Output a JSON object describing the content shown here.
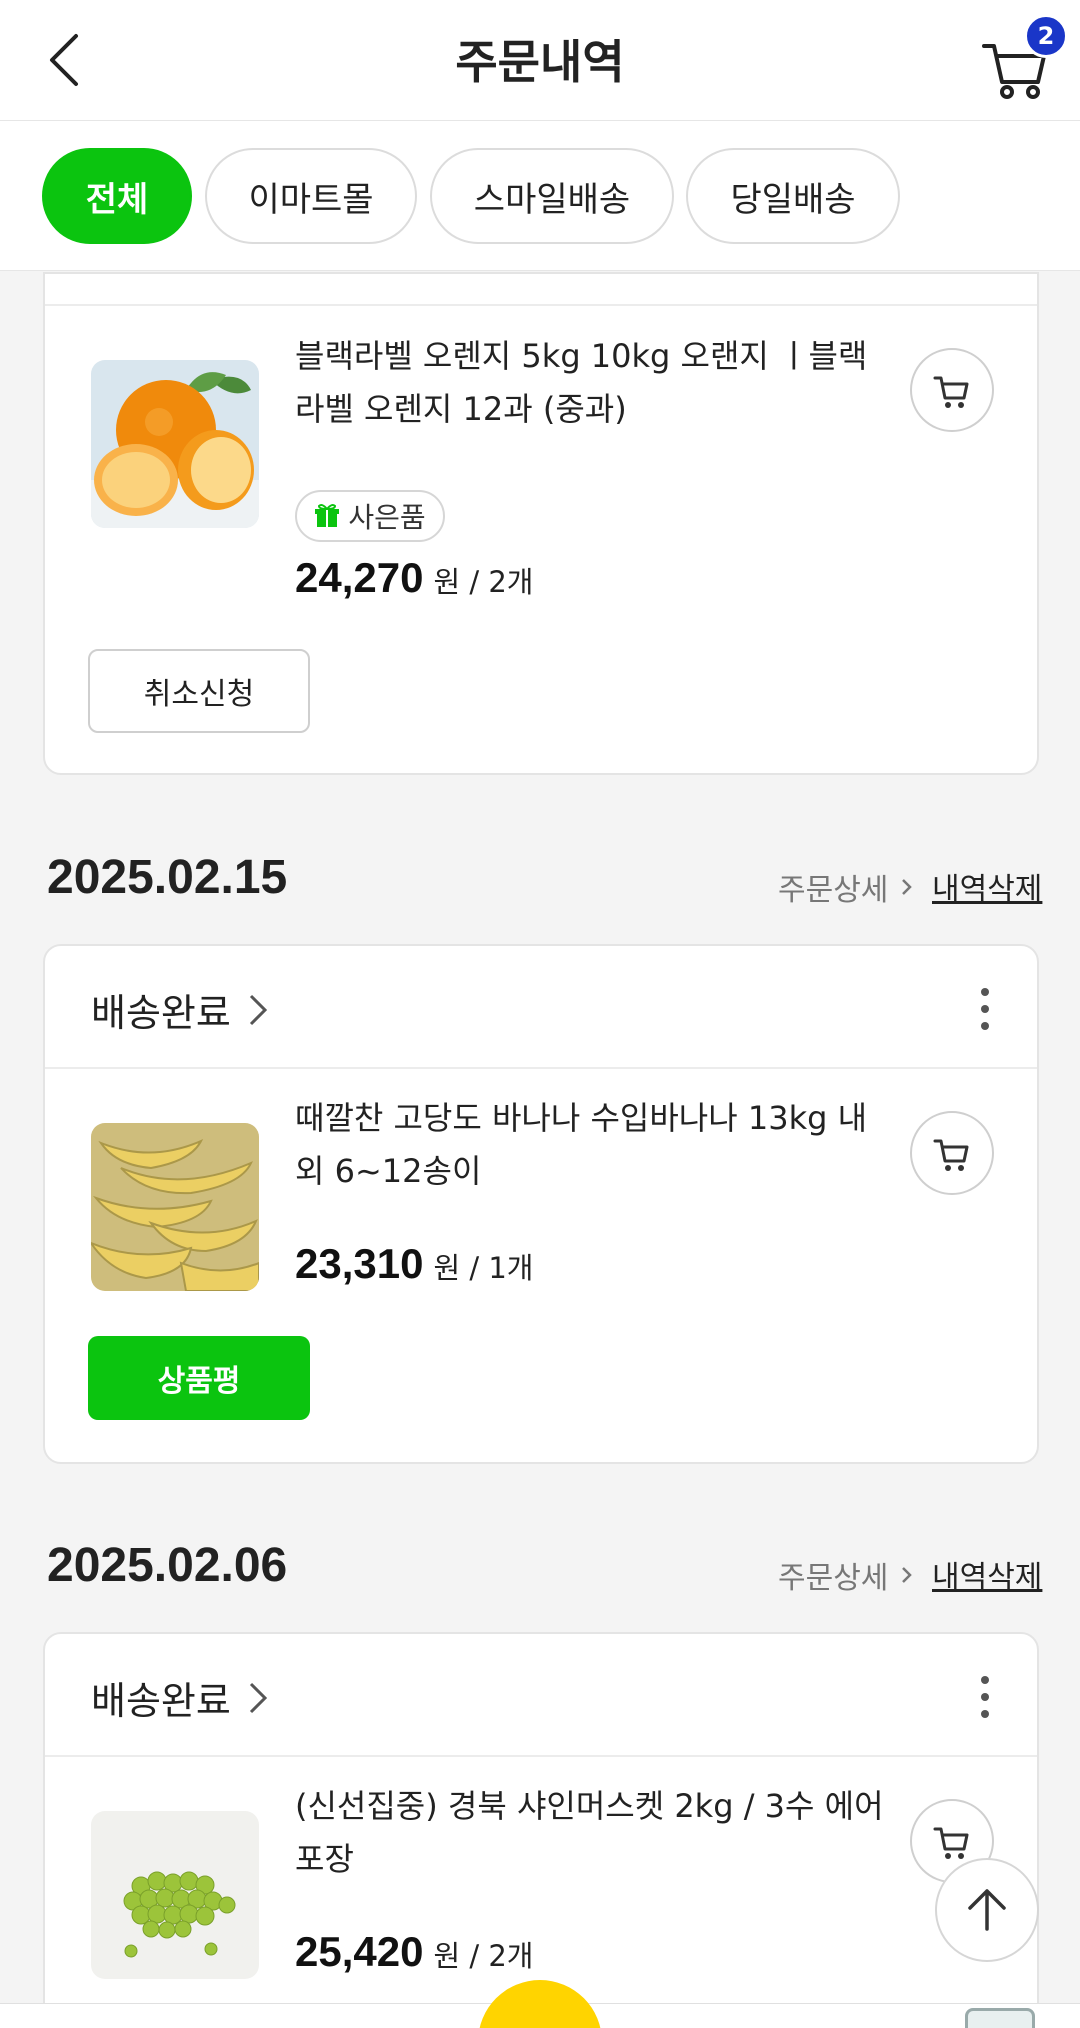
{
  "header": {
    "title": "주문내역",
    "cart_count": "2"
  },
  "tabs": [
    {
      "label": "전체",
      "active": true
    },
    {
      "label": "이마트몰",
      "active": false
    },
    {
      "label": "스마일배송",
      "active": false
    },
    {
      "label": "당일배송",
      "active": false
    }
  ],
  "order1": {
    "product_name": "블랙라벨 오렌지 5kg 10kg 오랜지 ㅣ블랙라벨 오렌지 12과 (중과)",
    "gift_label": "사은품",
    "price": "24,270",
    "unit": "원 / 2개",
    "action_label": "취소신청"
  },
  "order2": {
    "date": "2025.02.15",
    "detail_label": "주문상세",
    "delete_label": "내역삭제",
    "status": "배송완료",
    "product_name": "때깔찬 고당도 바나나 수입바나나 13kg 내외 6~12송이",
    "price": "23,310",
    "unit": "원 / 1개",
    "action_label": "상품평"
  },
  "order3": {
    "date": "2025.02.06",
    "detail_label": "주문상세",
    "delete_label": "내역삭제",
    "status": "배송완료",
    "product_name": "(신선집중) 경북 샤인머스켓 2kg / 3수 에어포장",
    "price": "25,420",
    "unit": "원 / 2개"
  },
  "colors": {
    "accent_green": "#0bc40f",
    "badge_blue": "#1a36c8"
  },
  "icons": [
    "back-arrow-icon",
    "cart-icon",
    "gift-icon",
    "chevron-right-icon",
    "more-vertical-icon",
    "arrow-up-icon"
  ]
}
